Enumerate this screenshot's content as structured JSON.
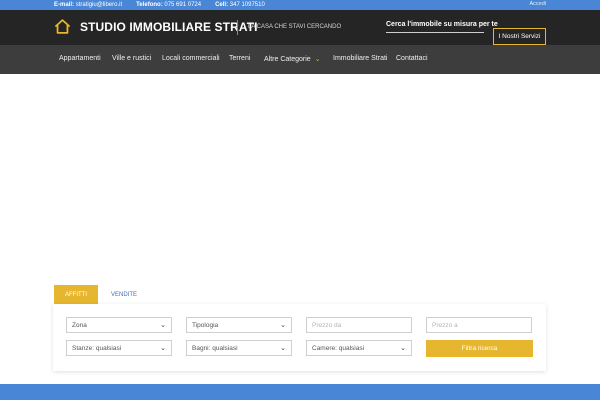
{
  "topbar": {
    "email_label": "E-mail:",
    "email_value": "stratigiu@libero.it",
    "phone_label": "Telefono:",
    "phone_value": "075 691 0724",
    "cell_label": "Cell:",
    "cell_value": "347 1097510",
    "login": "Accedi"
  },
  "header": {
    "brand": "STUDIO IMMOBILIARE STRATI",
    "tagline": "LA CASA CHE STAVI CERCANDO",
    "search_link": "Cerca l'immobile su misura per te",
    "services_button": "I Nostri Servizi"
  },
  "nav": {
    "items": [
      {
        "label": "Appartamenti"
      },
      {
        "label": "Ville e rustici"
      },
      {
        "label": "Locali commerciali"
      },
      {
        "label": "Terreni"
      },
      {
        "label": "Altre Categorie"
      },
      {
        "label": "Immobiliare Strati"
      },
      {
        "label": "Contattaci"
      }
    ]
  },
  "search": {
    "tabs": [
      {
        "label": "AFFITTI",
        "active": true
      },
      {
        "label": "VENDITE",
        "active": false
      }
    ],
    "zona": "Zona",
    "tipologia": "Tipologia",
    "prezzo_da": "Prezzo da",
    "prezzo_a": "Prezzo a",
    "stanze": "Stanze: qualsiasi",
    "bagni": "Bagni: qualsiasi",
    "camere": "Camere: qualsiasi",
    "filter_button": "Filtra ricerca"
  },
  "colors": {
    "accent": "#e7b62f",
    "topbar": "#4a86d6",
    "header": "#252525",
    "nav": "#3d3d3d"
  },
  "icons": {
    "logo": "house-outline-icon",
    "dropdown": "chevron-down-icon"
  }
}
